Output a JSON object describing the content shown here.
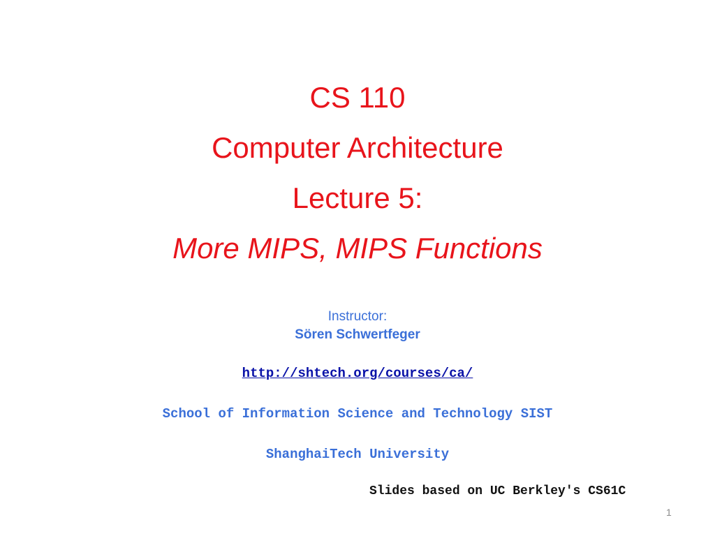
{
  "slide": {
    "title": {
      "course": "CS 110",
      "subject": "Computer Architecture",
      "lecture": "Lecture 5:",
      "topic": "More MIPS, MIPS Functions"
    },
    "instructor": {
      "label": "Instructor:",
      "name": "Sören Schwertfeger"
    },
    "url": "http://shtech.org/courses/ca/",
    "school": "School of Information Science and Technology SIST",
    "university": "ShanghaiTech University",
    "credit": "Slides based on UC Berkley's CS61C",
    "page_number": "1"
  },
  "colors": {
    "title": "#e8141b",
    "accent_blue": "#3a6fd8",
    "link": "#0a12a8"
  }
}
